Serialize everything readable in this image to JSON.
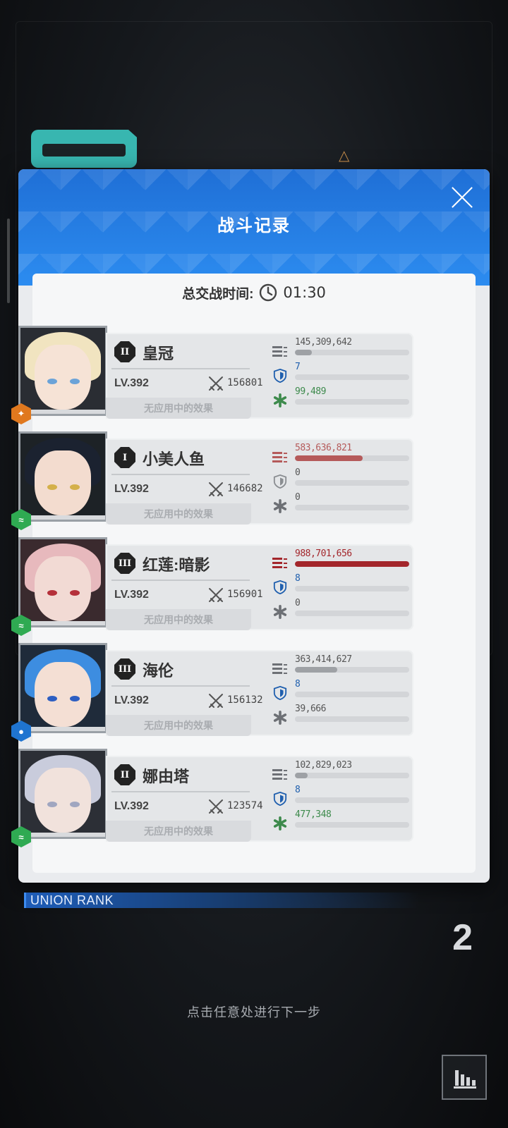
{
  "modal": {
    "title": "战斗记录",
    "time_label": "总交战时间:",
    "time_value": "01:30"
  },
  "characters": [
    {
      "burst": "II",
      "name": "皇冠",
      "level": "LV.392",
      "power": "156801",
      "effect": "无应用中的效果",
      "element": "iron",
      "element_color": "#e0781e",
      "damage": "145,309,642",
      "damage_ratio": 0.15,
      "shield": "7",
      "shield_ratio": 0,
      "heal": "99,489",
      "heal_ratio": 0,
      "damage_color": "#9ea1a5",
      "heal_color": "#3d8a4c"
    },
    {
      "burst": "I",
      "name": "小美人鱼",
      "level": "LV.392",
      "power": "146682",
      "effect": "无应用中的效果",
      "element": "wind",
      "element_color": "#2faa52",
      "damage": "583,636,821",
      "damage_ratio": 0.59,
      "shield": "0",
      "shield_ratio": 0,
      "heal": "0",
      "heal_ratio": 0,
      "damage_color": "#b55a5a",
      "heal_color": "#666"
    },
    {
      "burst": "III",
      "name": "红莲:暗影",
      "level": "LV.392",
      "power": "156901",
      "effect": "无应用中的效果",
      "element": "wind",
      "element_color": "#2faa52",
      "damage": "988,701,656",
      "damage_ratio": 1.0,
      "shield": "8",
      "shield_ratio": 0,
      "heal": "0",
      "heal_ratio": 0,
      "damage_color": "#a3262b",
      "heal_color": "#666"
    },
    {
      "burst": "III",
      "name": "海伦",
      "level": "LV.392",
      "power": "156132",
      "effect": "无应用中的效果",
      "element": "water",
      "element_color": "#1f74d0",
      "damage": "363,414,627",
      "damage_ratio": 0.37,
      "shield": "8",
      "shield_ratio": 0,
      "heal": "39,666",
      "heal_ratio": 0,
      "damage_color": "#9ea1a5",
      "heal_color": "#666"
    },
    {
      "burst": "II",
      "name": "娜由塔",
      "level": "LV.392",
      "power": "123574",
      "effect": "无应用中的效果",
      "element": "wind",
      "element_color": "#2faa52",
      "damage": "102,829,023",
      "damage_ratio": 0.11,
      "shield": "8",
      "shield_ratio": 0,
      "heal": "477,348",
      "heal_ratio": 0,
      "damage_color": "#9ea1a5",
      "heal_color": "#3d8a4c"
    }
  ],
  "footer": {
    "union_label": "UNION RANK",
    "rank_value": "2",
    "tap_hint": "点击任意处进行下一步"
  },
  "icons": [
    "close-icon",
    "clock-icon",
    "swords-icon",
    "damage-icon",
    "shield-icon",
    "heal-icon",
    "stats-chart-icon",
    "element-icon"
  ]
}
